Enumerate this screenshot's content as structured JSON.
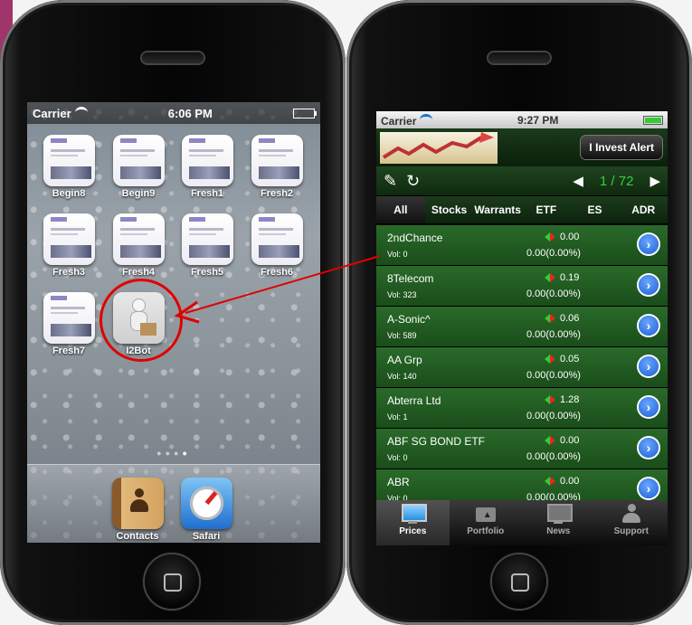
{
  "left_phone": {
    "status": {
      "carrier": "Carrier",
      "time": "6:06 PM"
    },
    "apps": [
      {
        "label": "Begin8",
        "icon": "book-cover-icon"
      },
      {
        "label": "Begin9",
        "icon": "book-cover-icon"
      },
      {
        "label": "Fresh1",
        "icon": "book-cover-icon"
      },
      {
        "label": "Fresh2",
        "icon": "book-cover-icon"
      },
      {
        "label": "Fresh3",
        "icon": "book-cover-icon"
      },
      {
        "label": "Fresh4",
        "icon": "book-cover-icon"
      },
      {
        "label": "Fresh5",
        "icon": "book-cover-icon"
      },
      {
        "label": "Fresh6",
        "icon": "book-cover-icon"
      },
      {
        "label": "Fresh7",
        "icon": "book-cover-icon"
      },
      {
        "label": "I2Bot",
        "icon": "robot-icon"
      }
    ],
    "page_dots": {
      "count": 4,
      "active": 4
    },
    "dock": [
      {
        "label": "Contacts",
        "icon": "contacts-icon"
      },
      {
        "label": "Safari",
        "icon": "safari-compass-icon"
      }
    ]
  },
  "right_phone": {
    "status": {
      "carrier": "Carrier",
      "time": "9:27 PM"
    },
    "header": {
      "alert_button": "I Invest Alert"
    },
    "toolbar": {
      "page": "1 / 72",
      "prev_icon": "◀",
      "next_icon": "▶",
      "wrench_icon": "wrench-icon",
      "refresh_icon": "refresh-icon"
    },
    "tabs": [
      "All",
      "Stocks",
      "Warrants",
      "ETF",
      "ES",
      "ADR"
    ],
    "active_tab": "All",
    "rows": [
      {
        "name": "2ndChance",
        "vol": "Vol: 0",
        "price": "0.00",
        "change": "0.00(0.00%)"
      },
      {
        "name": "8Telecom",
        "vol": "Vol: 323",
        "price": "0.19",
        "change": "0.00(0.00%)"
      },
      {
        "name": "A-Sonic^",
        "vol": "Vol: 589",
        "price": "0.06",
        "change": "0.00(0.00%)"
      },
      {
        "name": "AA Grp",
        "vol": "Vol: 140",
        "price": "0.05",
        "change": "0.00(0.00%)"
      },
      {
        "name": "Abterra Ltd",
        "vol": "Vol: 1",
        "price": "1.28",
        "change": "0.00(0.00%)"
      },
      {
        "name": "ABF SG BOND ETF",
        "vol": "Vol: 0",
        "price": "0.00",
        "change": "0.00(0.00%)"
      },
      {
        "name": "ABR",
        "vol": "Vol: 0",
        "price": "0.00",
        "change": "0.00(0.00%)"
      }
    ],
    "tabbar": [
      {
        "label": "Prices",
        "icon": "monitor-icon",
        "active": true
      },
      {
        "label": "Portfolio",
        "icon": "briefcase-icon",
        "active": false
      },
      {
        "label": "News",
        "icon": "monitor-icon",
        "active": false
      },
      {
        "label": "Support",
        "icon": "person-icon",
        "active": false
      }
    ]
  },
  "colors": {
    "annotation": "#e00000",
    "row_green": "#2a6a2a",
    "page_green": "#3bcc3b"
  }
}
